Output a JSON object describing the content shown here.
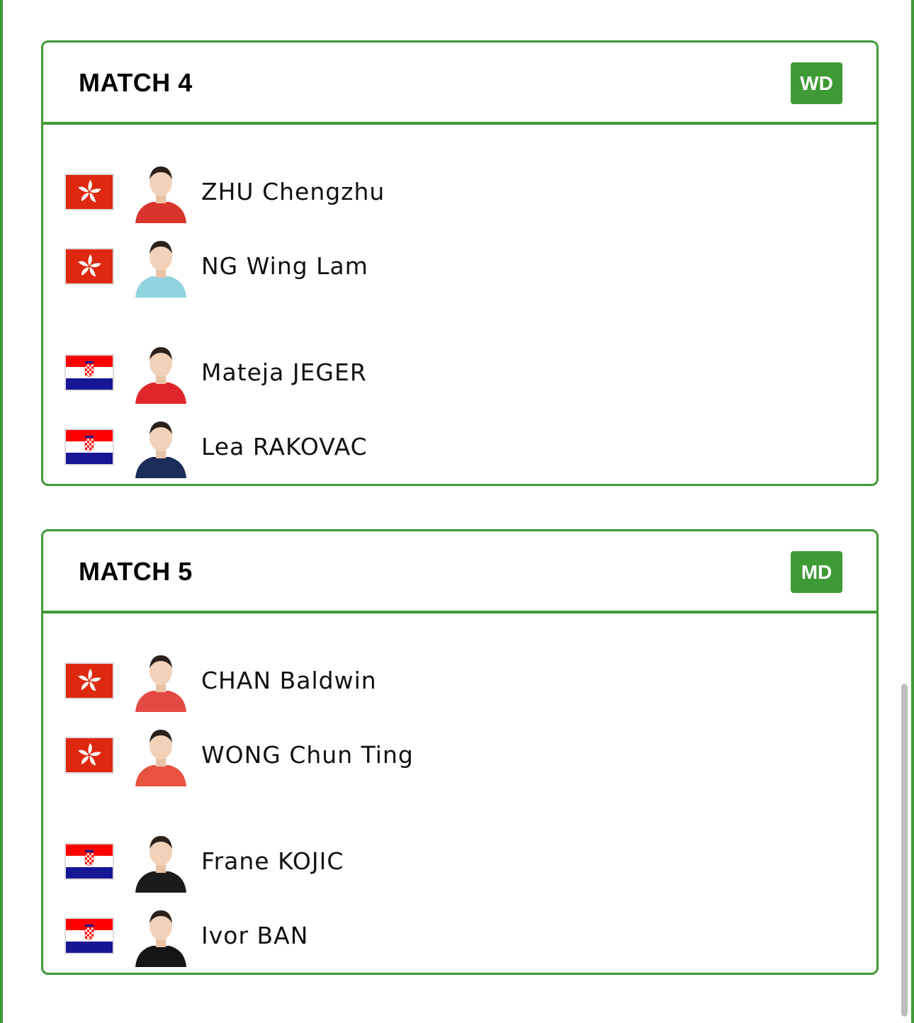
{
  "colors": {
    "accent": "#3e9a35",
    "hk_red": "#de2910",
    "cro_red": "#ff0000",
    "cro_blue": "#171796"
  },
  "matches": [
    {
      "title": "MATCH 4",
      "badge": "WD",
      "players": [
        {
          "name": "ZHU Chengzhu",
          "flag": "hong-kong-flag",
          "shirt": "#d9342b"
        },
        {
          "name": "NG Wing Lam",
          "flag": "hong-kong-flag",
          "shirt": "#8fd3df"
        },
        {
          "name": "Mateja JEGER",
          "flag": "croatia-flag",
          "shirt": "#e0262b"
        },
        {
          "name": "Lea RAKOVAC",
          "flag": "croatia-flag",
          "shirt": "#1c2d5a"
        }
      ]
    },
    {
      "title": "MATCH 5",
      "badge": "MD",
      "players": [
        {
          "name": "CHAN Baldwin",
          "flag": "hong-kong-flag",
          "shirt": "#e34a44"
        },
        {
          "name": "WONG Chun Ting",
          "flag": "hong-kong-flag",
          "shirt": "#e8523e"
        },
        {
          "name": "Frane KOJIC",
          "flag": "croatia-flag",
          "shirt": "#1b1b1b"
        },
        {
          "name": "Ivor BAN",
          "flag": "croatia-flag",
          "shirt": "#151515"
        }
      ]
    }
  ]
}
